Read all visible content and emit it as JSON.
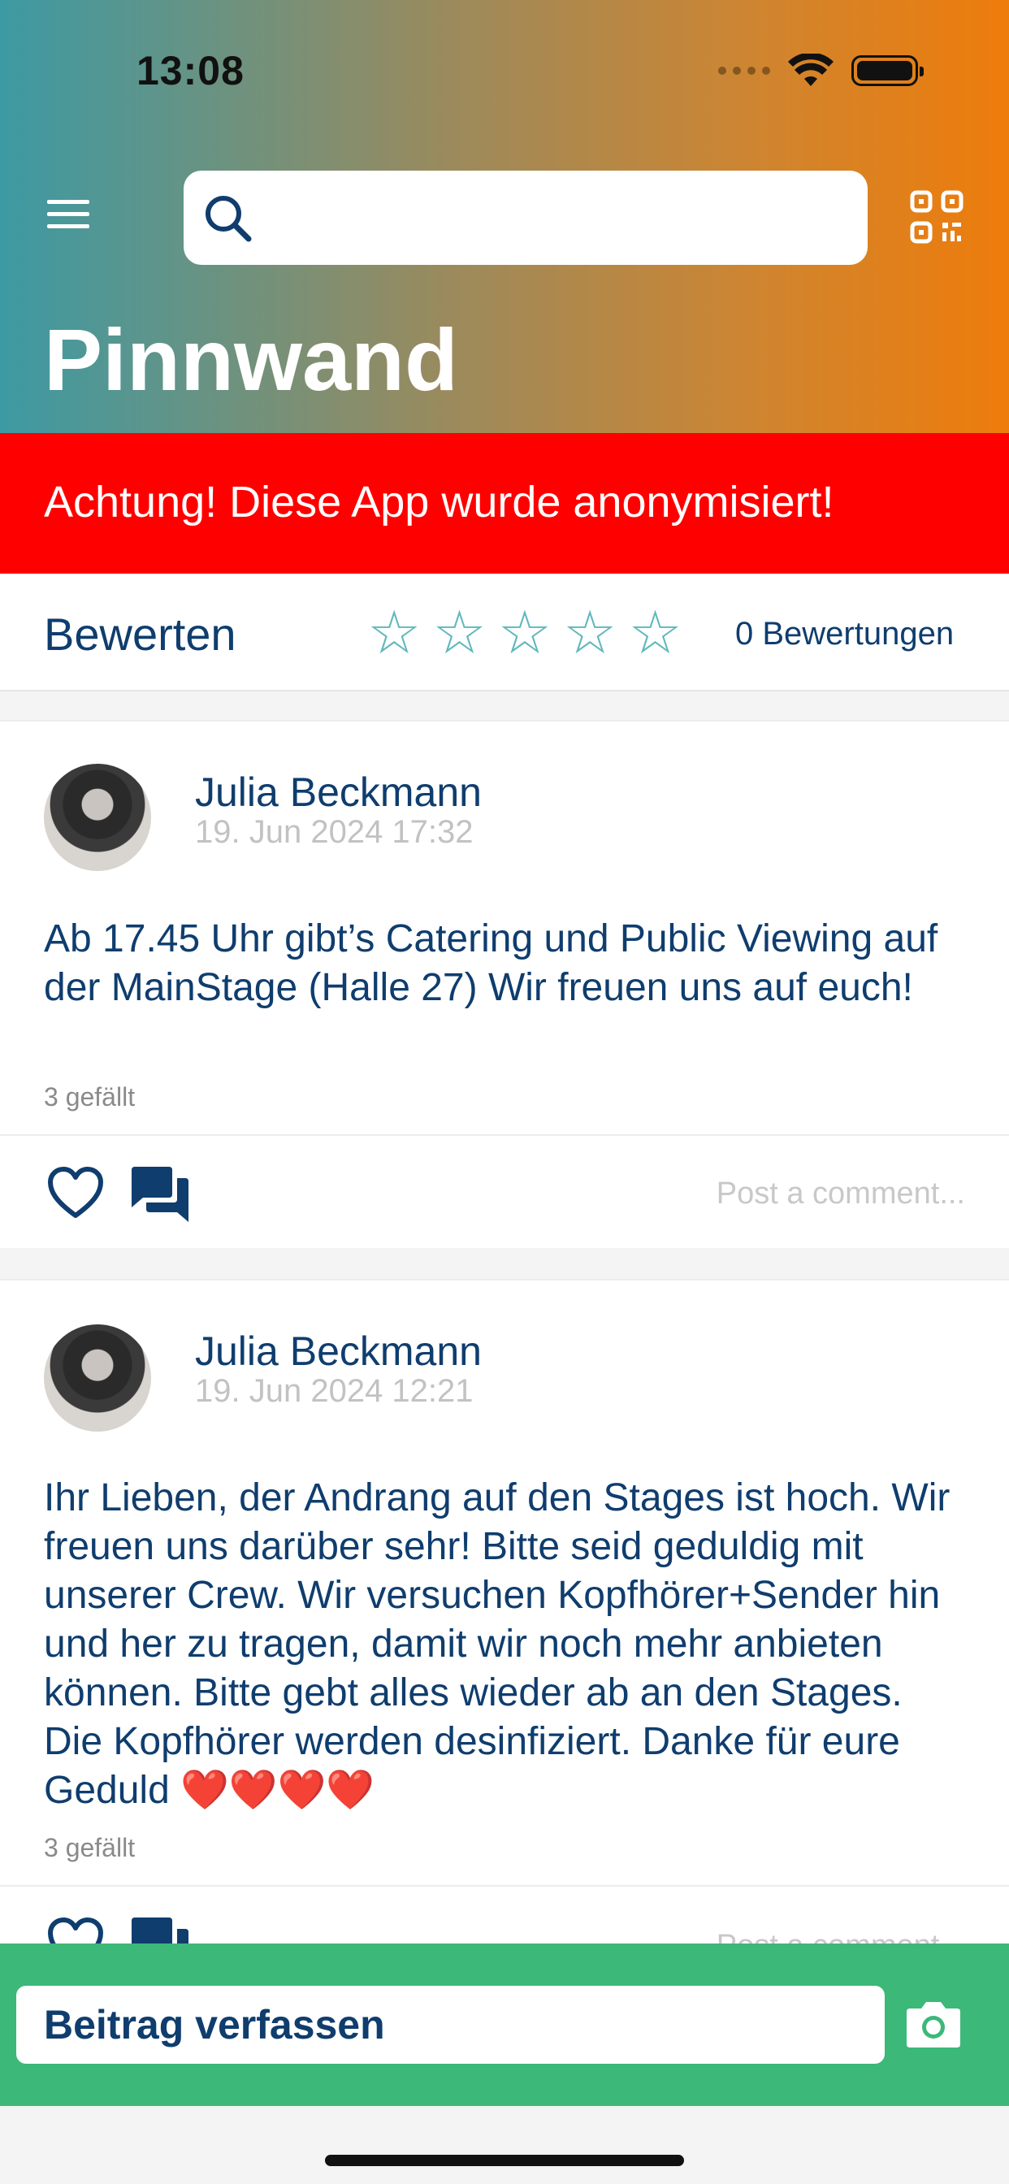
{
  "status_bar": {
    "time": "13:08"
  },
  "header": {
    "search_placeholder": "",
    "title": "Pinnwand"
  },
  "alert": {
    "text": "Achtung! Diese App wurde anonymisiert!"
  },
  "rating": {
    "label": "Bewerten",
    "stars": 5,
    "filled": 0,
    "count_text": "0 Bewertungen",
    "star_color": "#5fb8bc"
  },
  "posts": [
    {
      "author": "Julia Beckmann",
      "date": "19. Jun 2024 17:32",
      "body": "Ab 17.45 Uhr gibt’s Catering und Public Viewing auf der MainStage (Halle 27) Wir freuen uns auf euch!",
      "likes": "3 gefällt",
      "comment_placeholder": "Post a comment..."
    },
    {
      "author": "Julia Beckmann",
      "date": "19. Jun 2024 12:21",
      "body": "Ihr Lieben, der Andrang auf den Stages ist hoch. Wir freuen uns darüber sehr! Bitte seid geduldig mit unserer Crew. Wir versuchen Kopfhörer+Sender hin und her zu tragen, damit wir noch mehr anbieten können. Bitte gebt alles wieder ab an den Stages. Die Kopfhörer werden desinfiziert. Danke für eure Geduld ❤️❤️❤️❤️",
      "likes": "3 gefällt",
      "comment_placeholder": "Post a comment..."
    }
  ],
  "compose": {
    "label": "Beitrag verfassen"
  },
  "colors": {
    "brand_blue": "#0f3d6e",
    "alert_red": "#ff0000",
    "compose_green": "#3cb878",
    "header_gradient_start": "#3d9aa3",
    "header_gradient_end": "#ee7c0b"
  },
  "icons": [
    "menu-icon",
    "search-icon",
    "qr-code-icon",
    "star-icon",
    "heart-icon",
    "comment-icon",
    "camera-icon"
  ]
}
